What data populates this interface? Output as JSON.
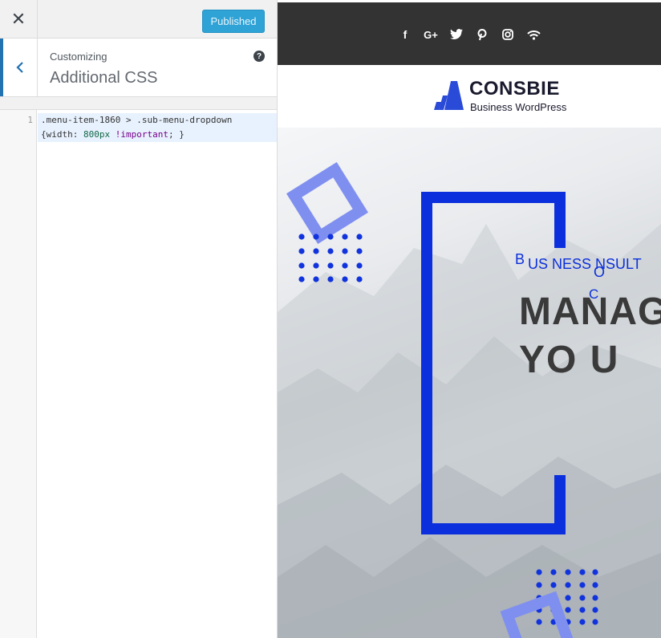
{
  "sidebar": {
    "close_icon": "close-icon",
    "publish_label": "Published",
    "customizing_label": "Customizing",
    "section_name": "Additional CSS",
    "help_icon": "?",
    "editor": {
      "line_number": "1",
      "code_line_1": ".menu-item-1860 > .sub-menu-dropdown",
      "code_line_2_prefix": "{width: ",
      "code_line_2_num": "800px",
      "code_line_2_kw": " !important",
      "code_line_2_suffix": "; }"
    }
  },
  "preview": {
    "social_icons": [
      "facebook-icon",
      "google-plus-icon",
      "twitter-icon",
      "pinterest-icon",
      "instagram-icon",
      "wifi-icon"
    ],
    "social_glyphs": [
      "f",
      "G+",
      "🐦",
      "P",
      "◎",
      "≋"
    ],
    "logo_name": "CONSBIE",
    "logo_tagline": "Business WordPress",
    "hero": {
      "b_letter": "B",
      "line_text": "US NESS   NSULT",
      "o_letter": "O",
      "c_letter": "C",
      "big_line_1": "MANAG",
      "big_line_2": "YO U"
    },
    "accent_color": "#0b2fdc",
    "publish_color": "#2fa3d6"
  }
}
